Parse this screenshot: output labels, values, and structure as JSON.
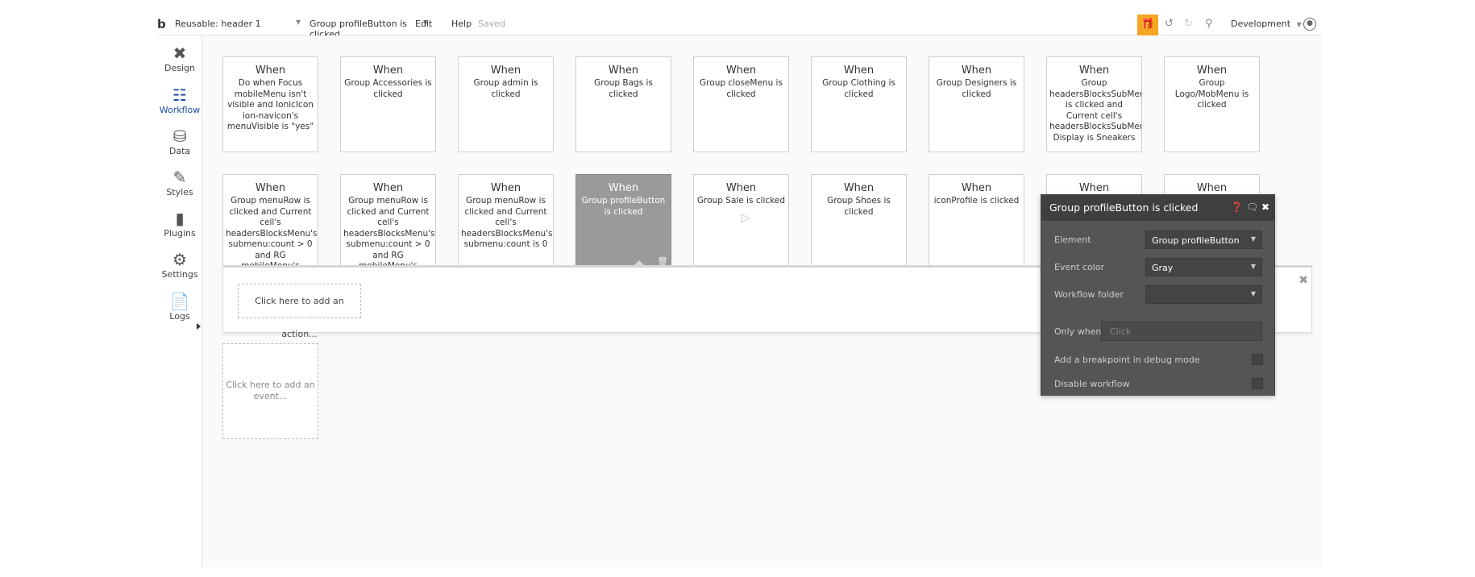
{
  "topbar": {
    "logo": "b",
    "page_select": "Reusable: header 1",
    "workflow_select": "Group profileButton is clicked",
    "edit": "Edit",
    "help": "Help",
    "saved": "Saved",
    "environment": "Development"
  },
  "sidebar": {
    "items": [
      {
        "label": "Design",
        "icon": "design-icon"
      },
      {
        "label": "Workflow",
        "icon": "workflow-icon"
      },
      {
        "label": "Data",
        "icon": "data-icon"
      },
      {
        "label": "Styles",
        "icon": "styles-icon"
      },
      {
        "label": "Plugins",
        "icon": "plugins-icon"
      },
      {
        "label": "Settings",
        "icon": "settings-icon"
      },
      {
        "label": "Logs",
        "icon": "logs-icon"
      }
    ]
  },
  "events_row1": [
    {
      "when": "When",
      "desc": "Do when Focus mobileMenu isn't visible and IonicIcon ion-navicon's menuVisible is \"yes\""
    },
    {
      "when": "When",
      "desc": "Group Accessories is clicked"
    },
    {
      "when": "When",
      "desc": "Group admin is clicked"
    },
    {
      "when": "When",
      "desc": "Group Bags is clicked"
    },
    {
      "when": "When",
      "desc": "Group closeMenu is clicked"
    },
    {
      "when": "When",
      "desc": "Group Clothing is clicked"
    },
    {
      "when": "When",
      "desc": "Group Designers is clicked"
    },
    {
      "when": "When",
      "desc": "Group headersBlocksSubMenu is clicked and Current cell's headersBlocksSubMenu Display is Sneakers"
    },
    {
      "when": "When",
      "desc": "Group Logo/MobMenu is clicked"
    }
  ],
  "events_row2": [
    {
      "when": "When",
      "desc": "Group menuRow is clicked and Current cell's headersBlocksMenu's submenu:count > 0 and RG mobileMenu's activeMenu is Current"
    },
    {
      "when": "When",
      "desc": "Group menuRow is clicked and Current cell's headersBlocksMenu's submenu:count > 0 and RG mobileMenu's activeMenu is not"
    },
    {
      "when": "When",
      "desc": "Group menuRow is clicked and Current cell's headersBlocksMenu's submenu:count is 0"
    },
    {
      "when": "When",
      "desc": "Group profileButton is clicked"
    },
    {
      "when": "When",
      "desc": "Group Sale is clicked"
    },
    {
      "when": "When",
      "desc": "Group Shoes is clicked"
    },
    {
      "when": "When",
      "desc": "iconProfile is clicked"
    },
    {
      "when": "When",
      "desc": ""
    },
    {
      "when": "When",
      "desc": ""
    }
  ],
  "add_action": "Click here to add an action...",
  "add_event": "Click here to add an event...",
  "panel": {
    "title": "Group profileButton is clicked",
    "element_label": "Element",
    "element_value": "Group profileButton",
    "event_color_label": "Event color",
    "event_color_value": "Gray",
    "folder_label": "Workflow folder",
    "folder_value": "",
    "only_when_label": "Only when",
    "only_when_placeholder": "Click",
    "breakpoint_label": "Add a breakpoint in debug mode",
    "disable_label": "Disable workflow"
  }
}
